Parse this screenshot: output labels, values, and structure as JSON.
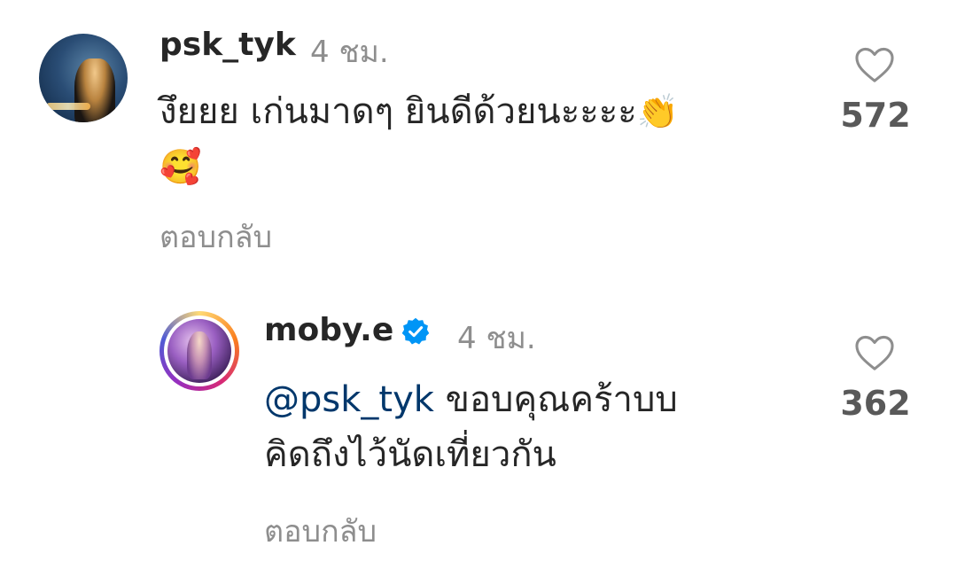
{
  "comments": [
    {
      "username": "psk_tyk",
      "time": "4 ชม.",
      "text": "งึยยย เก่นมาดๆ ยินดีด้วยนะะะะ",
      "emoji_line1": "👏",
      "emoji_line2": "🥰",
      "likes": "572",
      "reply_label": "ตอบกลับ",
      "verified": false,
      "avatar": "user-photo"
    },
    {
      "username": "moby.e",
      "time": "4 ชม.",
      "mention": "@psk_tyk",
      "text_line1": "ขอบคุณคร้าบบ",
      "text_line2": "คิดถึงไว้นัดเที่ยวกัน",
      "likes": "362",
      "reply_label": "ตอบกลับ",
      "verified": true,
      "avatar": "user-photo-story-ring"
    }
  ],
  "icons": {
    "like": "heart-outline-icon",
    "verified": "verified-badge-icon"
  },
  "colors": {
    "text": "#262626",
    "muted": "#8e8e8e",
    "mention": "#00376b",
    "verified": "#0095f6"
  }
}
